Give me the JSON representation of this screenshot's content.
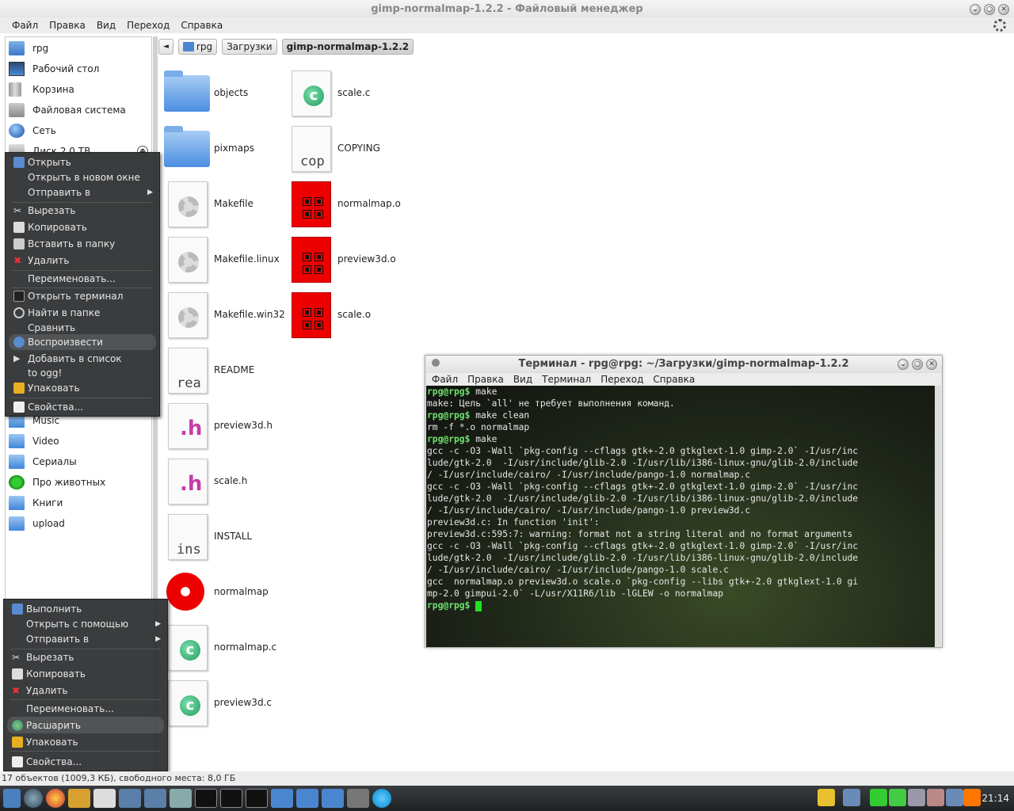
{
  "window": {
    "title": "gimp-normalmap-1.2.2 - Файловый менеджер"
  },
  "menu": [
    "Файл",
    "Правка",
    "Вид",
    "Переход",
    "Справка"
  ],
  "sidebar": {
    "items": [
      {
        "label": "rpg",
        "icon": "home-folder-icon"
      },
      {
        "label": "Рабочий стол",
        "icon": "desktop-icon"
      },
      {
        "label": "Корзина",
        "icon": "trash-icon"
      },
      {
        "label": "Файловая система",
        "icon": "filesystem-icon"
      },
      {
        "label": "Сеть",
        "icon": "network-icon"
      },
      {
        "label": "Диск 2,0 TB",
        "icon": "disk-icon"
      },
      {
        "label": "Music",
        "icon": "folder-icon"
      },
      {
        "label": "Video",
        "icon": "folder-icon"
      },
      {
        "label": "Сериалы",
        "icon": "folder-icon"
      },
      {
        "label": "Про животных",
        "icon": "checked-folder-icon"
      },
      {
        "label": "Книги",
        "icon": "folder-icon"
      },
      {
        "label": "upload",
        "icon": "folder-icon"
      }
    ]
  },
  "pathbar": {
    "back": "◄",
    "crumbs": [
      "rpg",
      "Загрузки",
      "gimp-normalmap-1.2.2"
    ]
  },
  "files": {
    "col1": [
      "objects",
      "pixmaps",
      "Makefile",
      "Makefile.linux",
      "Makefile.win32",
      "README",
      "preview3d.h",
      "scale.h",
      "INSTALL",
      "normalmap",
      "normalmap.c",
      "preview3d.c"
    ],
    "col2": [
      "scale.c",
      "COPYING",
      "normalmap.o",
      "preview3d.o",
      "scale.o"
    ],
    "thumb_text": {
      "readme": "rea",
      "install": "ins",
      "copying": "cop"
    }
  },
  "context_menu_1": {
    "items": [
      "Открыть",
      "Открыть в новом окне",
      "Отправить в",
      "Вырезать",
      "Копировать",
      "Вставить в папку",
      "Удалить",
      "Переименовать...",
      "Открыть терминал",
      "Найти в папке",
      "Сравнить",
      "Воспроизвести",
      "Добавить в список",
      "to ogg!",
      "Упаковать",
      "Свойства..."
    ]
  },
  "context_menu_2": {
    "items": [
      "Выполнить",
      "Открыть с помощью",
      "Отправить в",
      "Вырезать",
      "Копировать",
      "Удалить",
      "Переименовать...",
      "Расшарить",
      "Упаковать",
      "Свойства..."
    ]
  },
  "terminal": {
    "title": "Терминал - rpg@rpg: ~/Загрузки/gimp-normalmap-1.2.2",
    "menu": [
      "Файл",
      "Правка",
      "Вид",
      "Терминал",
      "Переход",
      "Справка"
    ],
    "prompt": "rpg@rpg$",
    "lines": [
      {
        "p": true,
        "t": " make"
      },
      {
        "p": false,
        "t": "make: Цель `all' не требует выполнения команд."
      },
      {
        "p": true,
        "t": " make clean"
      },
      {
        "p": false,
        "t": "rm -f *.o normalmap"
      },
      {
        "p": true,
        "t": " make"
      },
      {
        "p": false,
        "t": "gcc -c -O3 -Wall `pkg-config --cflags gtk+-2.0 gtkglext-1.0 gimp-2.0` -I/usr/inc"
      },
      {
        "p": false,
        "t": "lude/gtk-2.0  -I/usr/include/glib-2.0 -I/usr/lib/i386-linux-gnu/glib-2.0/include"
      },
      {
        "p": false,
        "t": "/ -I/usr/include/cairo/ -I/usr/include/pango-1.0 normalmap.c"
      },
      {
        "p": false,
        "t": "gcc -c -O3 -Wall `pkg-config --cflags gtk+-2.0 gtkglext-1.0 gimp-2.0` -I/usr/inc"
      },
      {
        "p": false,
        "t": "lude/gtk-2.0  -I/usr/include/glib-2.0 -I/usr/lib/i386-linux-gnu/glib-2.0/include"
      },
      {
        "p": false,
        "t": "/ -I/usr/include/cairo/ -I/usr/include/pango-1.0 preview3d.c"
      },
      {
        "p": false,
        "t": "preview3d.c: In function 'init':"
      },
      {
        "p": false,
        "t": "preview3d.c:595:7: warning: format not a string literal and no format arguments"
      },
      {
        "p": false,
        "t": "gcc -c -O3 -Wall `pkg-config --cflags gtk+-2.0 gtkglext-1.0 gimp-2.0` -I/usr/inc"
      },
      {
        "p": false,
        "t": "lude/gtk-2.0  -I/usr/include/glib-2.0 -I/usr/lib/i386-linux-gnu/glib-2.0/include"
      },
      {
        "p": false,
        "t": "/ -I/usr/include/cairo/ -I/usr/include/pango-1.0 scale.c"
      },
      {
        "p": false,
        "t": "gcc  normalmap.o preview3d.o scale.o `pkg-config --libs gtk+-2.0 gtkglext-1.0 gi"
      },
      {
        "p": false,
        "t": "mp-2.0 gimpui-2.0` -L/usr/X11R6/lib -lGLEW -o normalmap"
      },
      {
        "p": true,
        "t": " "
      }
    ]
  },
  "status": "17 объектов (1009,3 КБ), свободного места: 8,0 ГБ",
  "clock": "21:14",
  "colors": {
    "prompt": "#6ee36e",
    "object_file": "#ee0000",
    "menu_bg": "#323436"
  }
}
